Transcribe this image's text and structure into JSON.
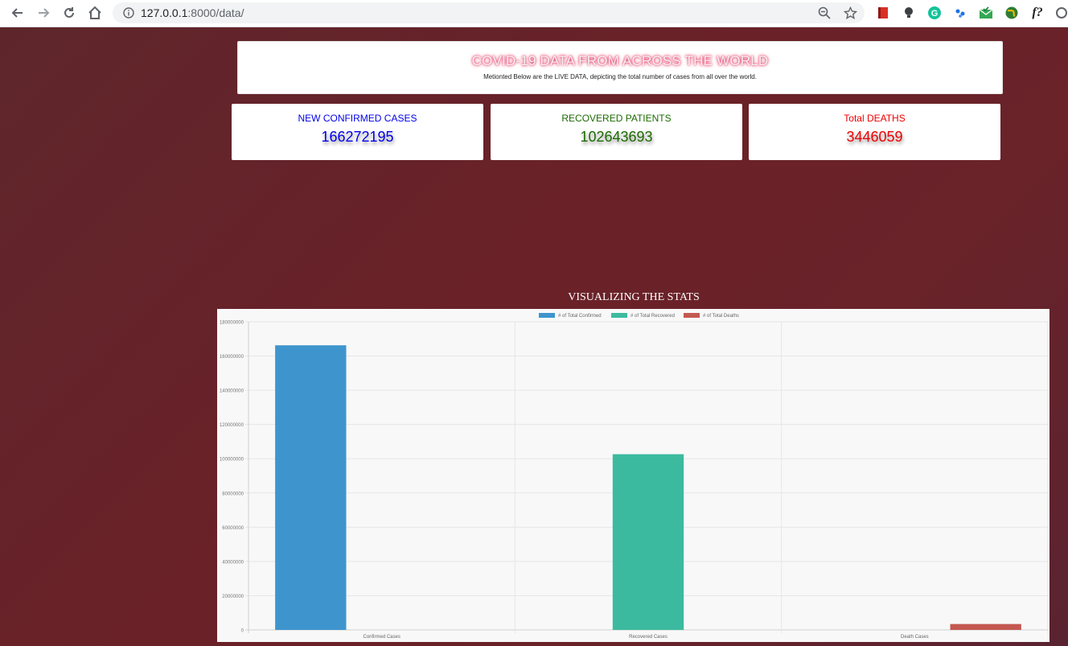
{
  "browser": {
    "url_host": "127.0.0.1",
    "url_path": ":8000/data/",
    "icons": [
      "back-icon",
      "forward-icon",
      "reload-icon",
      "home-icon",
      "info-icon",
      "zoom-icon",
      "bookmark-star-icon"
    ],
    "extension_text": "f?"
  },
  "header": {
    "title": "COVID-19 DATA FROM ACROSS THE WORLD",
    "subtitle": "Metionted Below are the LIVE DATA, depicting the total number of cases from all over the world."
  },
  "stats": [
    {
      "label": "NEW CONFIRMED CASES",
      "value": "166272195",
      "color": "#0000ee"
    },
    {
      "label": "RECOVERED PATIENTS",
      "value": "102643693",
      "color": "#1c6b00"
    },
    {
      "label": "Total DEATHS",
      "value": "3446059",
      "color": "#ee0000"
    }
  ],
  "viz_title": "VISUALIZING THE STATS",
  "chart_data": {
    "type": "bar",
    "categories": [
      "Confirmed Cases",
      "Recovered Cases",
      "Death Cases"
    ],
    "series": [
      {
        "name": "# of Total Confirmed",
        "color": "#3e95cd",
        "values": [
          166272195,
          null,
          null
        ]
      },
      {
        "name": "# of Total Recovered",
        "color": "#3cba9f",
        "values": [
          null,
          102643693,
          null
        ]
      },
      {
        "name": "# of Total Deaths",
        "color": "#c45850",
        "values": [
          null,
          null,
          3446059
        ]
      }
    ],
    "ylim": [
      0,
      180000000
    ],
    "yticks": [
      "0",
      "20000000",
      "40000000",
      "60000000",
      "80000000",
      "100000000",
      "120000000",
      "140000000",
      "160000000",
      "180000000"
    ],
    "legend": "top",
    "grid": true
  }
}
